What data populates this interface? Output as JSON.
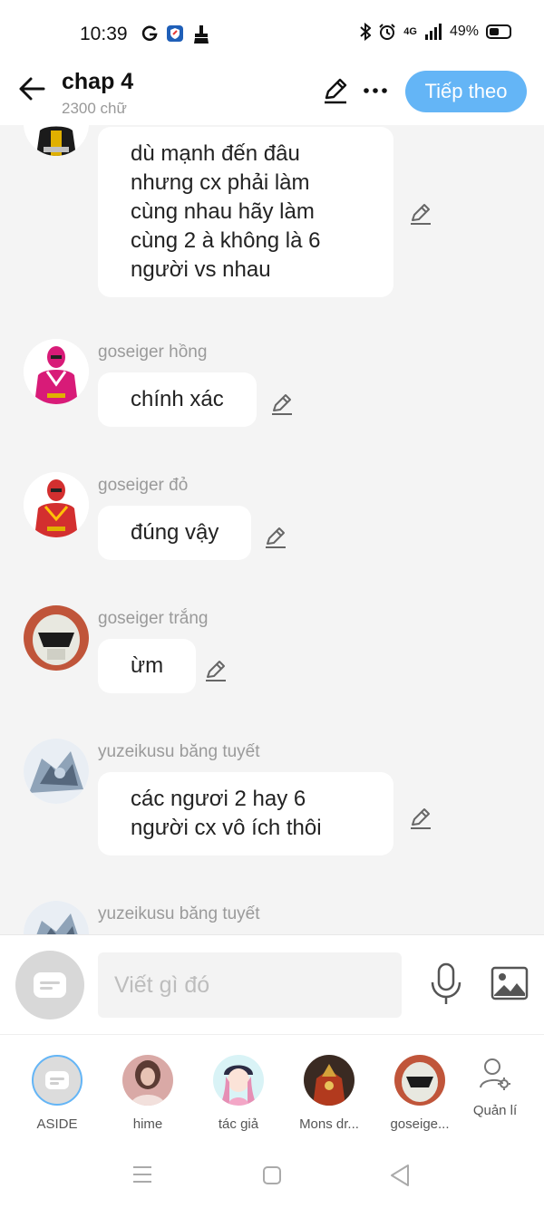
{
  "status_bar": {
    "time": "10:39",
    "network": "4G",
    "battery": "49%"
  },
  "header": {
    "title": "chap 4",
    "word_count": "2300 chữ",
    "next_label": "Tiếp theo"
  },
  "messages": [
    {
      "sender": "",
      "lines": [
        "dù mạnh đến đâu",
        "nhưng cx phải làm",
        "cùng nhau hãy làm",
        "cùng 2 à không là 6",
        "người vs nhau"
      ]
    },
    {
      "sender": "goseiger hồng",
      "lines": [
        "chính xác"
      ]
    },
    {
      "sender": "goseiger đỏ",
      "lines": [
        "đúng vậy"
      ]
    },
    {
      "sender": "goseiger trắng",
      "lines": [
        "ừm"
      ]
    },
    {
      "sender": "yuzeikusu băng tuyết",
      "lines": [
        "các ngươi 2 hay 6",
        "người cx vô ích thôi"
      ]
    },
    {
      "sender": "yuzeikusu băng tuyết",
      "lines": []
    }
  ],
  "composer": {
    "placeholder": "Viết gì đó"
  },
  "characters": [
    {
      "label": "ASIDE"
    },
    {
      "label": "hime"
    },
    {
      "label": "tác giả"
    },
    {
      "label": "Mons dr..."
    },
    {
      "label": "goseige..."
    },
    {
      "label": "Quản lí"
    }
  ],
  "colors": {
    "accent": "#64b5f6",
    "background": "#f4f4f4",
    "bubble": "#ffffff"
  },
  "icons": [
    "back-arrow-icon",
    "pencil-icon",
    "more-icon",
    "mic-icon",
    "image-icon",
    "manage-users-icon",
    "menu-nav-icon",
    "home-nav-icon",
    "back-nav-icon"
  ]
}
